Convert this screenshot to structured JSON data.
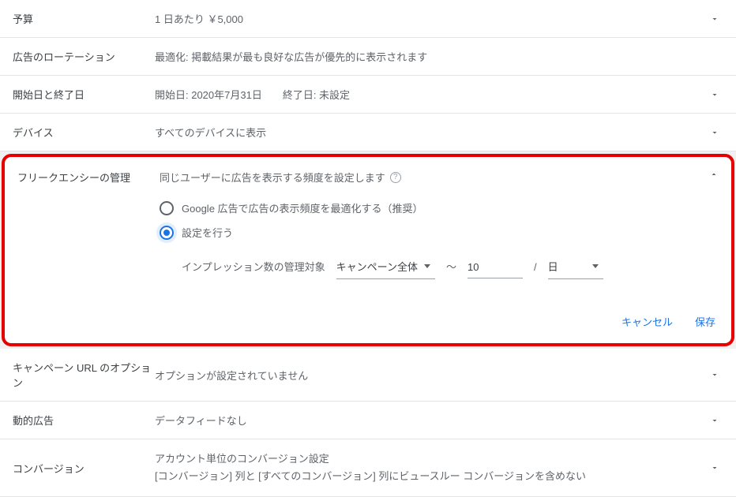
{
  "rows": {
    "budget": {
      "label": "予算",
      "value": "1 日あたり  ￥5,000"
    },
    "adRotation": {
      "label": "広告のローテーション",
      "value": "最適化: 掲載結果が最も良好な広告が優先的に表示されます"
    },
    "dates": {
      "label": "開始日と終了日",
      "value": "開始日: 2020年7月31日  終了日: 未設定"
    },
    "devices": {
      "label": "デバイス",
      "value": "すべてのデバイスに表示"
    },
    "urlOptions": {
      "label": "キャンペーン URL のオプション",
      "value": "オプションが設定されていません"
    },
    "dynamicAds": {
      "label": "動的広告",
      "value": "データフィードなし"
    },
    "conversions": {
      "label": "コンバージョン",
      "line1": "アカウント単位のコンバージョン設定",
      "line2": "[コンバージョン] 列と [すべてのコンバージョン] 列にビュースルー コンバージョンを含めない"
    }
  },
  "frequency": {
    "label": "フリークエンシーの管理",
    "description": "同じユーザーに広告を表示する頻度を設定します",
    "option1": "Google 広告で広告の表示頻度を最適化する（推奨）",
    "option2": "設定を行う",
    "impressionTargetLabel": "インプレッション数の管理対象",
    "scopeValue": "キャンペーン全体",
    "tilde": "～",
    "countValue": "10",
    "slash": "/",
    "periodValue": "日"
  },
  "actions": {
    "cancel": "キャンセル",
    "save": "保存"
  }
}
